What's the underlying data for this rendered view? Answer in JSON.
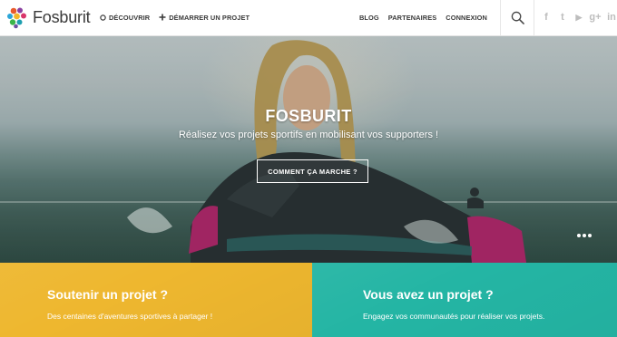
{
  "header": {
    "brand": "Fosburit",
    "nav_left": [
      {
        "label": "DÉCOUVRIR",
        "icon": "compass-icon"
      },
      {
        "label": "DÉMARRER UN PROJET",
        "icon": "plus-icon"
      }
    ],
    "nav_right": [
      {
        "label": "BLOG"
      },
      {
        "label": "PARTENAIRES"
      },
      {
        "label": "CONNEXION"
      }
    ],
    "social": [
      {
        "name": "facebook-icon",
        "glyph": "f"
      },
      {
        "name": "twitter-icon",
        "glyph": "t"
      },
      {
        "name": "youtube-icon",
        "glyph": "▶"
      },
      {
        "name": "google-plus-icon",
        "glyph": "g+"
      },
      {
        "name": "linkedin-icon",
        "glyph": "in"
      }
    ]
  },
  "hero": {
    "title": "FOSBURIT",
    "subtitle": "Réalisez vos projets sportifs en mobilisant vos supporters !",
    "cta": "COMMENT ÇA MARCHE ?",
    "slide_count": 3
  },
  "cards": {
    "left": {
      "title": "Soutenir un projet ?",
      "text": "Des centaines d'aventures sportives à partager !"
    },
    "right": {
      "title": "Vous avez un projet ?",
      "text": "Engagez vos communautés pour réaliser vos projets."
    }
  },
  "colors": {
    "header_text": "#3a3a3a",
    "yellow": "#eeb72f",
    "teal": "#24b5a4",
    "social_gray": "#bdbdbd"
  }
}
